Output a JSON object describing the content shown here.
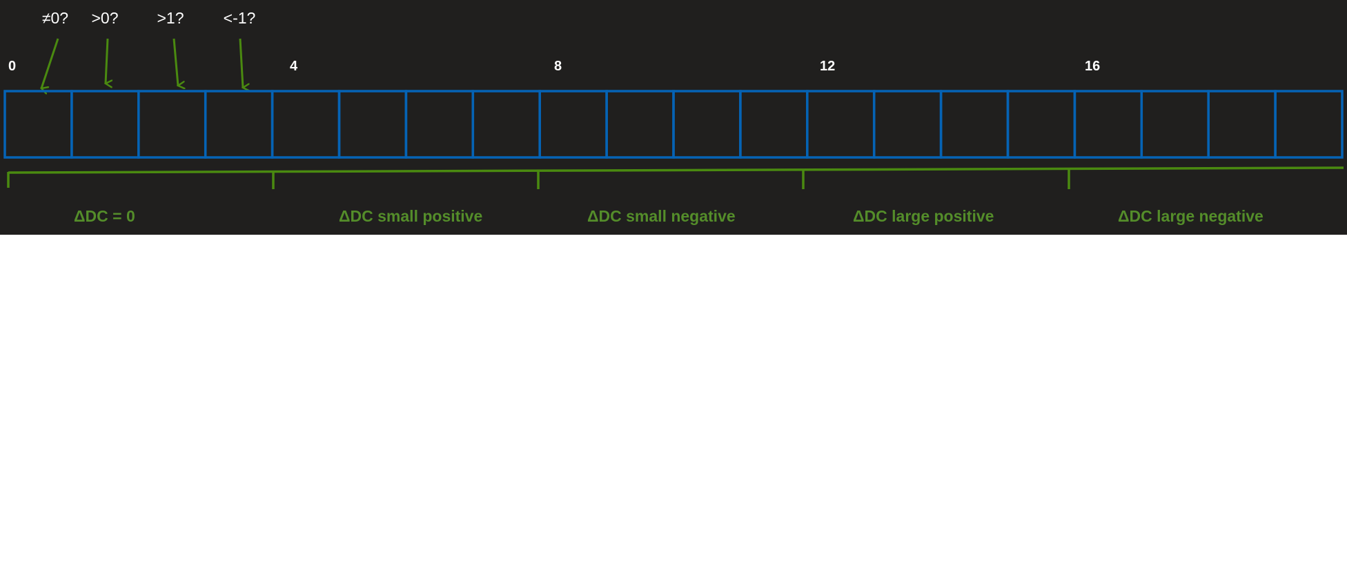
{
  "colors": {
    "background": "#201f1e",
    "cell_border": "#0563b5",
    "accent_green": "#4a8a10",
    "label_green": "#548d2a",
    "text_white": "#ffffff"
  },
  "questions": [
    "≠0?",
    ">0?",
    ">1?",
    "<-1?"
  ],
  "cells": {
    "count": 20
  },
  "index_labels": [
    "0",
    "4",
    "8",
    "12",
    "16"
  ],
  "ranges": [
    {
      "label": "ΔDC = 0"
    },
    {
      "label": "ΔDC small positive"
    },
    {
      "label": "ΔDC small negative"
    },
    {
      "label": "ΔDC large positive"
    },
    {
      "label": "ΔDC large negative"
    }
  ]
}
